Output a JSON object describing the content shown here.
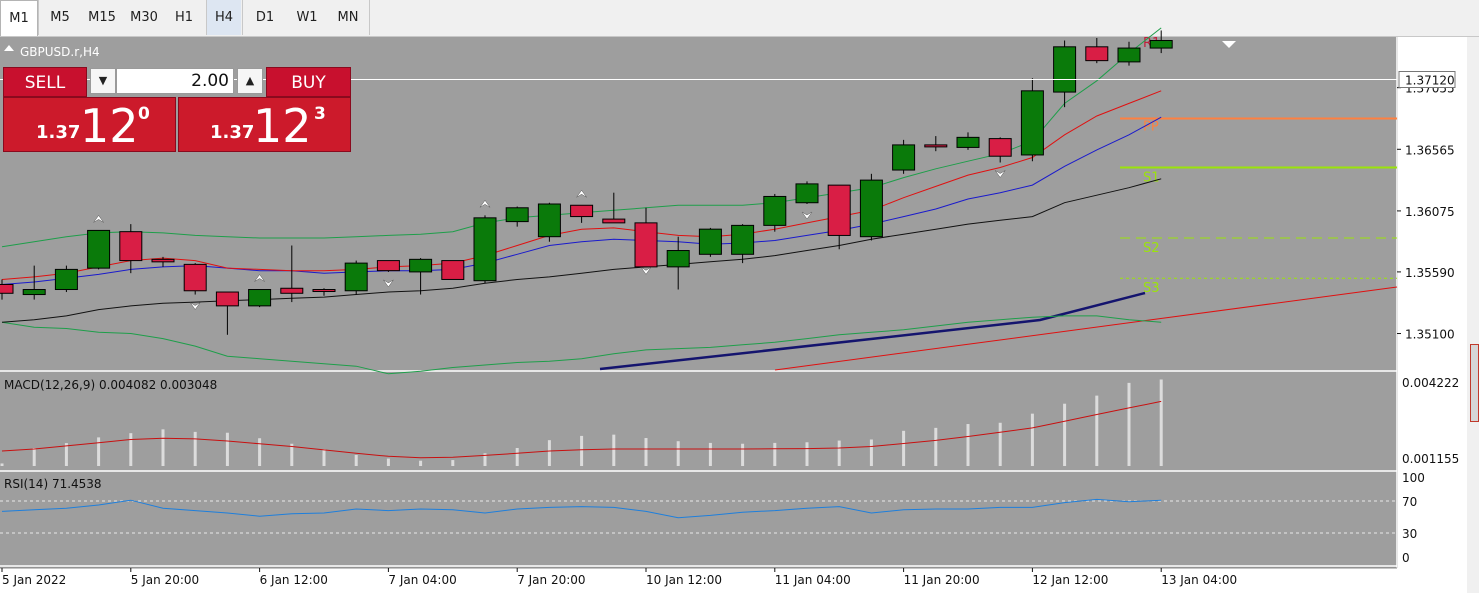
{
  "toolbar": {
    "timeframes": [
      "M1",
      "M5",
      "M15",
      "M30",
      "H1",
      "H4",
      "D1",
      "W1",
      "MN"
    ],
    "active_timeframe": "H4"
  },
  "chart_header": {
    "symbol_label": "GBPUSD.r,H4",
    "arrow_glyph": "▲"
  },
  "trade_panel": {
    "sell_label": "SELL",
    "buy_label": "BUY",
    "lot_value": "2.00",
    "sell_price_prefix": "1.37",
    "sell_price_main": "12",
    "sell_price_sup": "0",
    "buy_price_prefix": "1.37",
    "buy_price_main": "12",
    "buy_price_sup": "3",
    "spin_down_glyph": "▼",
    "spin_up_glyph": "▲"
  },
  "colors": {
    "chart_bg": "#9e9e9e",
    "bull": "#0a7a0a",
    "bear": "#d91e45",
    "ma_red": "#e01010",
    "ma_blue": "#1a1acc",
    "ma_black": "#111111",
    "bollinger": "#1e9e4a",
    "long_ma": "#14146e",
    "trend": "#e01010",
    "pivot_r1": "#c0203c",
    "pivot_pp": "#ff8040",
    "pivot_s": "#9be40a"
  },
  "chart_data": [
    {
      "type": "candlestick",
      "title": "GBPUSD.r,H4",
      "x_tick_labels": [
        "5 Jan 2022",
        "5 Jan 20:00",
        "6 Jan 12:00",
        "7 Jan 04:00",
        "7 Jan 20:00",
        "10 Jan 12:00",
        "11 Jan 04:00",
        "11 Jan 20:00",
        "12 Jan 12:00",
        "13 Jan 04:00"
      ],
      "y_tick_labels": [
        "1.37120",
        "1.37055",
        "1.36565",
        "1.36075",
        "1.35590",
        "1.35100"
      ],
      "ylim": [
        1.3481,
        1.3745
      ],
      "current_price": 1.3712,
      "candles": [
        {
          "o": 1.3549,
          "h": 1.3553,
          "l": 1.3537,
          "c": 1.3542
        },
        {
          "o": 1.3541,
          "h": 1.3564,
          "l": 1.3537,
          "c": 1.3545
        },
        {
          "o": 1.3545,
          "h": 1.3564,
          "l": 1.3543,
          "c": 1.3561
        },
        {
          "o": 1.3562,
          "h": 1.3592,
          "l": 1.3561,
          "c": 1.3592
        },
        {
          "o": 1.3591,
          "h": 1.3597,
          "l": 1.3558,
          "c": 1.3568
        },
        {
          "o": 1.3569,
          "h": 1.3571,
          "l": 1.3563,
          "c": 1.3567
        },
        {
          "o": 1.3565,
          "h": 1.3566,
          "l": 1.3541,
          "c": 1.3544
        },
        {
          "o": 1.3543,
          "h": 1.3543,
          "l": 1.3509,
          "c": 1.3532
        },
        {
          "o": 1.3532,
          "h": 1.3545,
          "l": 1.3531,
          "c": 1.3545
        },
        {
          "o": 1.3546,
          "h": 1.358,
          "l": 1.3535,
          "c": 1.3542
        },
        {
          "o": 1.3545,
          "h": 1.3546,
          "l": 1.354,
          "c": 1.3544
        },
        {
          "o": 1.3544,
          "h": 1.3568,
          "l": 1.3541,
          "c": 1.3566
        },
        {
          "o": 1.3568,
          "h": 1.3568,
          "l": 1.3559,
          "c": 1.356
        },
        {
          "o": 1.3559,
          "h": 1.357,
          "l": 1.3541,
          "c": 1.3569
        },
        {
          "o": 1.3568,
          "h": 1.3568,
          "l": 1.3553,
          "c": 1.3553
        },
        {
          "o": 1.3552,
          "h": 1.3604,
          "l": 1.355,
          "c": 1.3602
        },
        {
          "o": 1.3599,
          "h": 1.3611,
          "l": 1.3595,
          "c": 1.361
        },
        {
          "o": 1.3587,
          "h": 1.3614,
          "l": 1.3583,
          "c": 1.3613
        },
        {
          "o": 1.3612,
          "h": 1.3612,
          "l": 1.3598,
          "c": 1.3603
        },
        {
          "o": 1.3601,
          "h": 1.3622,
          "l": 1.3598,
          "c": 1.3598
        },
        {
          "o": 1.3598,
          "h": 1.361,
          "l": 1.3569,
          "c": 1.3563
        },
        {
          "o": 1.3563,
          "h": 1.3587,
          "l": 1.3545,
          "c": 1.3576
        },
        {
          "o": 1.3573,
          "h": 1.3594,
          "l": 1.3571,
          "c": 1.3593
        },
        {
          "o": 1.3573,
          "h": 1.3597,
          "l": 1.3566,
          "c": 1.3596
        },
        {
          "o": 1.3596,
          "h": 1.3621,
          "l": 1.3591,
          "c": 1.3619
        },
        {
          "o": 1.3614,
          "h": 1.3631,
          "l": 1.3613,
          "c": 1.3629
        },
        {
          "o": 1.3628,
          "h": 1.3628,
          "l": 1.3577,
          "c": 1.3588
        },
        {
          "o": 1.3587,
          "h": 1.3637,
          "l": 1.3584,
          "c": 1.3632
        },
        {
          "o": 1.364,
          "h": 1.3664,
          "l": 1.3637,
          "c": 1.366
        },
        {
          "o": 1.366,
          "h": 1.3667,
          "l": 1.3655,
          "c": 1.3659
        },
        {
          "o": 1.3658,
          "h": 1.367,
          "l": 1.3656,
          "c": 1.3666
        },
        {
          "o": 1.3665,
          "h": 1.3666,
          "l": 1.3646,
          "c": 1.3651
        },
        {
          "o": 1.3652,
          "h": 1.3713,
          "l": 1.3647,
          "c": 1.3703
        },
        {
          "o": 1.3702,
          "h": 1.3743,
          "l": 1.369,
          "c": 1.3738
        },
        {
          "o": 1.3738,
          "h": 1.3745,
          "l": 1.3725,
          "c": 1.3727
        },
        {
          "o": 1.3726,
          "h": 1.3742,
          "l": 1.3723,
          "c": 1.3737
        },
        {
          "o": 1.3737,
          "h": 1.3751,
          "l": 1.3733,
          "c": 1.3743
        }
      ],
      "overlays": {
        "ma_red": [
          1.3553,
          1.3555,
          1.3558,
          1.3563,
          1.3568,
          1.357,
          1.3568,
          1.3562,
          1.3561,
          1.356,
          1.356,
          1.3561,
          1.3563,
          1.3564,
          1.3566,
          1.3572,
          1.358,
          1.3588,
          1.3593,
          1.3594,
          1.3591,
          1.3588,
          1.3587,
          1.3589,
          1.3593,
          1.3598,
          1.3603,
          1.3608,
          1.3618,
          1.3627,
          1.3636,
          1.3642,
          1.365,
          1.3668,
          1.3683,
          1.3693,
          1.3703
        ],
        "ma_blue": [
          1.3549,
          1.3551,
          1.3554,
          1.3557,
          1.3561,
          1.3563,
          1.3564,
          1.3562,
          1.356,
          1.356,
          1.3558,
          1.3559,
          1.356,
          1.356,
          1.3561,
          1.3566,
          1.3573,
          1.358,
          1.3583,
          1.3585,
          1.3584,
          1.3583,
          1.3581,
          1.3582,
          1.3584,
          1.3588,
          1.3592,
          1.3597,
          1.3603,
          1.3609,
          1.3617,
          1.3622,
          1.3628,
          1.3643,
          1.3656,
          1.3668,
          1.3682
        ],
        "ma_black": [
          1.3519,
          1.3521,
          1.3524,
          1.3529,
          1.3532,
          1.3534,
          1.3535,
          1.3536,
          1.3537,
          1.3538,
          1.3539,
          1.3541,
          1.3543,
          1.3544,
          1.3546,
          1.355,
          1.3553,
          1.3555,
          1.3558,
          1.3561,
          1.3563,
          1.3565,
          1.3567,
          1.3569,
          1.3572,
          1.3576,
          1.358,
          1.3585,
          1.3589,
          1.3593,
          1.3597,
          1.36,
          1.3603,
          1.3614,
          1.362,
          1.3626,
          1.3633
        ],
        "bb_upper": [
          1.3579,
          1.3583,
          1.3587,
          1.359,
          1.3591,
          1.359,
          1.3588,
          1.3587,
          1.3586,
          1.3586,
          1.3586,
          1.3587,
          1.3588,
          1.3589,
          1.3591,
          1.3598,
          1.3602,
          1.3604,
          1.3606,
          1.3608,
          1.361,
          1.3612,
          1.3612,
          1.3612,
          1.3614,
          1.3618,
          1.3622,
          1.3626,
          1.3634,
          1.3641,
          1.3647,
          1.3653,
          1.3663,
          1.3693,
          1.3711,
          1.3733,
          1.3753
        ],
        "bb_lower": [
          1.3519,
          1.3515,
          1.3514,
          1.3511,
          1.351,
          1.3506,
          1.35,
          1.3492,
          1.349,
          1.3488,
          1.3486,
          1.3484,
          1.3478,
          1.348,
          1.3483,
          1.3485,
          1.3487,
          1.3488,
          1.349,
          1.3494,
          1.3497,
          1.3498,
          1.3499,
          1.3501,
          1.3503,
          1.3506,
          1.3509,
          1.3511,
          1.3513,
          1.3516,
          1.3519,
          1.3521,
          1.3523,
          1.3524,
          1.3524,
          1.3521,
          1.3519
        ]
      },
      "pivots": {
        "R1": 1.373,
        "PP": 1.3681,
        "S1": 1.3642,
        "S2": 1.3586,
        "S3": 1.3554
      }
    },
    {
      "type": "bar",
      "title": "MACD(12,26,9) 0.004082 0.003048",
      "y_tick_labels": [
        "0.004222",
        "0.001155"
      ],
      "ylim": [
        0.0,
        0.0042
      ],
      "histogram": [
        0.00012,
        0.00085,
        0.00108,
        0.00135,
        0.00155,
        0.00173,
        0.00161,
        0.00157,
        0.00131,
        0.00105,
        0.0008,
        0.00052,
        0.00035,
        0.00025,
        0.00028,
        0.0006,
        0.00085,
        0.00122,
        0.00142,
        0.00148,
        0.00132,
        0.00117,
        0.00109,
        0.00105,
        0.00109,
        0.00112,
        0.0012,
        0.00125,
        0.00166,
        0.0018,
        0.00198,
        0.00204,
        0.00247,
        0.00294,
        0.00332,
        0.00392,
        0.00408
      ],
      "signal": [
        0.00071,
        0.0008,
        0.00095,
        0.0011,
        0.00125,
        0.00131,
        0.00128,
        0.00118,
        0.00105,
        0.00092,
        0.00076,
        0.0006,
        0.00046,
        0.00039,
        0.00041,
        0.0005,
        0.0006,
        0.00071,
        0.00077,
        0.0008,
        0.0008,
        0.0008,
        0.0008,
        0.0008,
        0.00081,
        0.00082,
        0.00085,
        0.00092,
        0.00106,
        0.00121,
        0.00139,
        0.00159,
        0.0018,
        0.00211,
        0.00243,
        0.00274,
        0.00305
      ]
    },
    {
      "type": "line",
      "title": "RSI(14) 71.4538",
      "y_tick_labels": [
        "100",
        "70",
        "30",
        "0"
      ],
      "ylim": [
        0,
        100
      ],
      "levels": [
        70,
        30
      ],
      "values": [
        57,
        59,
        61,
        65,
        71,
        61,
        58,
        55,
        51,
        54,
        55,
        60,
        58,
        60,
        59,
        55,
        60,
        62,
        63,
        62,
        57,
        49,
        52,
        56,
        58,
        61,
        63,
        55,
        59,
        60,
        60,
        62,
        62,
        68,
        72,
        69,
        71
      ]
    }
  ]
}
